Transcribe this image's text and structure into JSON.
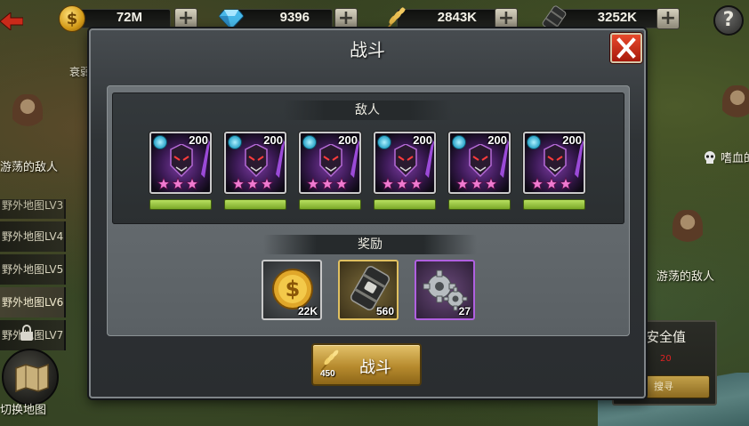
{
  "resources": [
    {
      "name": "gold",
      "icon": "gold-coin-icon",
      "value": "72M"
    },
    {
      "name": "diamonds",
      "icon": "diamond-icon",
      "value": "9396"
    },
    {
      "name": "wheat",
      "icon": "wheat-icon",
      "value": "2843K"
    },
    {
      "name": "oil",
      "icon": "oil-barrel-icon",
      "value": "3252K"
    }
  ],
  "help_label": "?",
  "map_labels": {
    "wandering_enemy_left": "游荡的敌人",
    "wandering_enemy_right": "游荡的敌人",
    "bloodthirst": "嗜血的",
    "faint_top_left": "衰弱"
  },
  "side_list": [
    {
      "label": "野外地图LV3",
      "state": "partial"
    },
    {
      "label": "野外地图LV4",
      "state": "normal"
    },
    {
      "label": "野外地图LV5",
      "state": "normal"
    },
    {
      "label": "野外地图LV6",
      "state": "active"
    },
    {
      "label": "野外地图LV7",
      "state": "locked"
    }
  ],
  "switch_map_label": "切换地图",
  "right_panel": {
    "title": "安全值",
    "value": "20",
    "button_label": "搜寻"
  },
  "dialog": {
    "title": "战斗",
    "enemies_header": "敌人",
    "rewards_header": "奖励",
    "enemies": [
      {
        "level": "200",
        "stars": 3,
        "hp": 1.0
      },
      {
        "level": "200",
        "stars": 3,
        "hp": 1.0
      },
      {
        "level": "200",
        "stars": 3,
        "hp": 1.0
      },
      {
        "level": "200",
        "stars": 3,
        "hp": 1.0
      },
      {
        "level": "200",
        "stars": 3,
        "hp": 1.0
      },
      {
        "level": "200",
        "stars": 3,
        "hp": 1.0
      }
    ],
    "rewards": [
      {
        "icon": "gold-coin-icon",
        "amount": "22K",
        "frame": "#c9c9c9"
      },
      {
        "icon": "oil-barrel-icon",
        "amount": "560",
        "frame": "#e0c060"
      },
      {
        "icon": "gears-icon",
        "amount": "27",
        "frame": "#b060e0"
      }
    ],
    "fight_button_label": "战斗",
    "fight_cost": "450",
    "fight_cost_icon": "wheat-icon"
  },
  "colors": {
    "close_button": "#c8301a",
    "hp_bar": "#9bcf3c",
    "fight_button": "#c9a248",
    "star": "#f07ad0"
  }
}
